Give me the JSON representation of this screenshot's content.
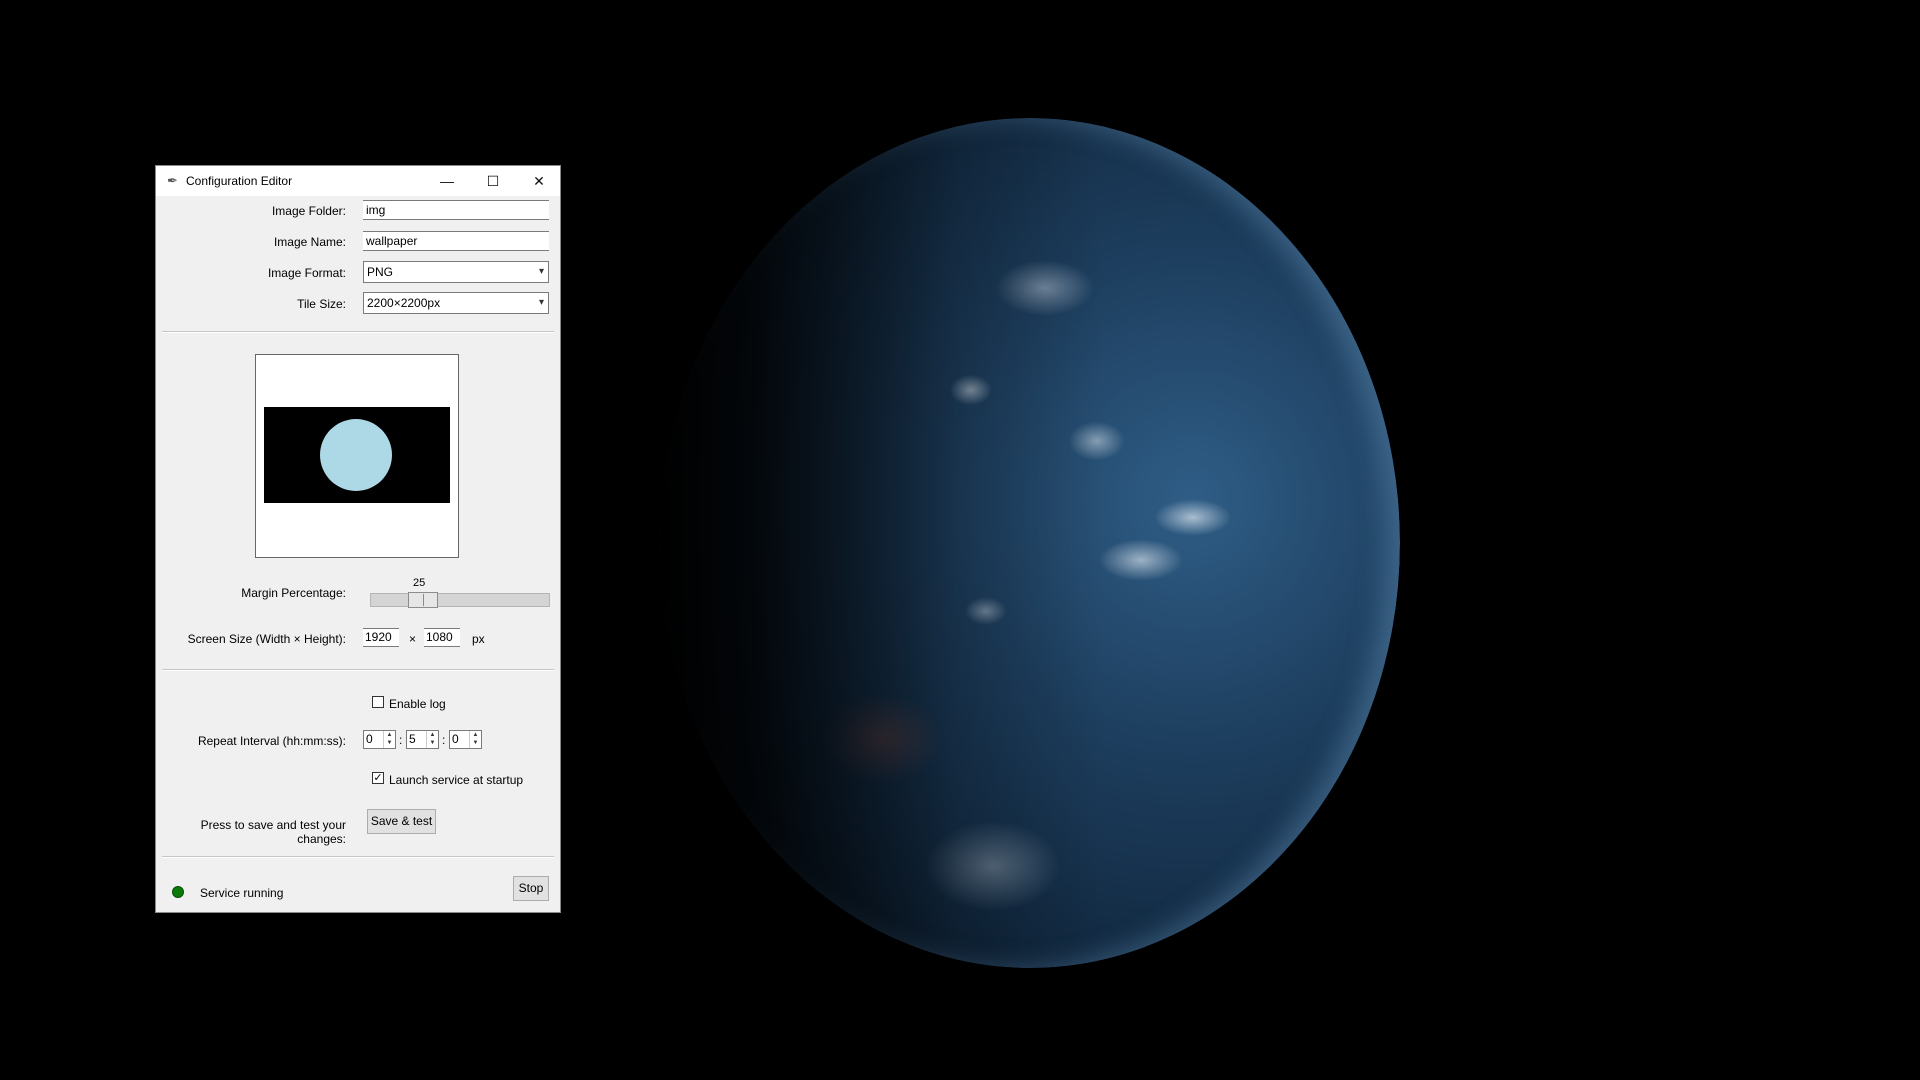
{
  "window": {
    "title": "Configuration Editor",
    "minimize_glyph": "—",
    "maximize_glyph": "☐",
    "close_glyph": "✕"
  },
  "fields": {
    "image_folder_label": "Image Folder:",
    "image_folder_value": "img",
    "image_name_label": "Image Name:",
    "image_name_value": "wallpaper",
    "image_format_label": "Image Format:",
    "image_format_value": "PNG",
    "tile_size_label": "Tile Size:",
    "tile_size_value": "2200×2200px"
  },
  "margin": {
    "label": "Margin Percentage:",
    "value": "25",
    "slider_fraction": 0.25
  },
  "screen_size": {
    "label": "Screen Size (Width × Height):",
    "width": "1920",
    "times": "×",
    "height": "1080",
    "unit": "px"
  },
  "log": {
    "label": "Enable log",
    "checked": false
  },
  "repeat": {
    "label": "Repeat Interval (hh:mm:ss):",
    "hours": "0",
    "minutes": "5",
    "seconds": "0",
    "sep": ":"
  },
  "startup": {
    "label": "Launch service at startup",
    "checked": true,
    "check_glyph": "✓"
  },
  "save": {
    "prompt": "Press to save and test your changes:",
    "button": "Save & test"
  },
  "status": {
    "text": "Service running",
    "dot_color": "#0a7a0a",
    "stop_button": "Stop"
  },
  "icons": {
    "app": "feather-icon",
    "dropdown": "▾",
    "spin_up": "▲",
    "spin_down": "▼"
  }
}
